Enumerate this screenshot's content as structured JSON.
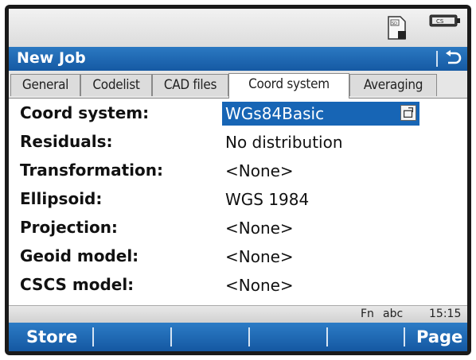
{
  "title": "New Job",
  "tabs": [
    {
      "label": "General",
      "active": false
    },
    {
      "label": "Codelist",
      "active": false
    },
    {
      "label": "CAD files",
      "active": false
    },
    {
      "label": "Coord system",
      "active": true
    },
    {
      "label": "Averaging",
      "active": false
    }
  ],
  "fields": [
    {
      "label": "Coord system:",
      "value": "WGs84Basic",
      "selected": true
    },
    {
      "label": "Residuals:",
      "value": "No distribution"
    },
    {
      "label": "Transformation:",
      "value": "<None>"
    },
    {
      "label": "Ellipsoid:",
      "value": "WGS 1984"
    },
    {
      "label": "Projection:",
      "value": "<None>"
    },
    {
      "label": "Geoid model:",
      "value": "<None>"
    },
    {
      "label": "CSCS model:",
      "value": "<None>"
    }
  ],
  "status_line": {
    "fn": "Fn",
    "input_mode": "abc",
    "time": "15:15"
  },
  "softkeys": {
    "f1": "Store",
    "f6": "Page"
  },
  "icons": {
    "sd_card": "sd-card-icon",
    "battery": "battery-icon",
    "back": "back-arrow-icon"
  },
  "colors": {
    "accent": "#1765b5",
    "title_bar": "#1f6bb5"
  }
}
